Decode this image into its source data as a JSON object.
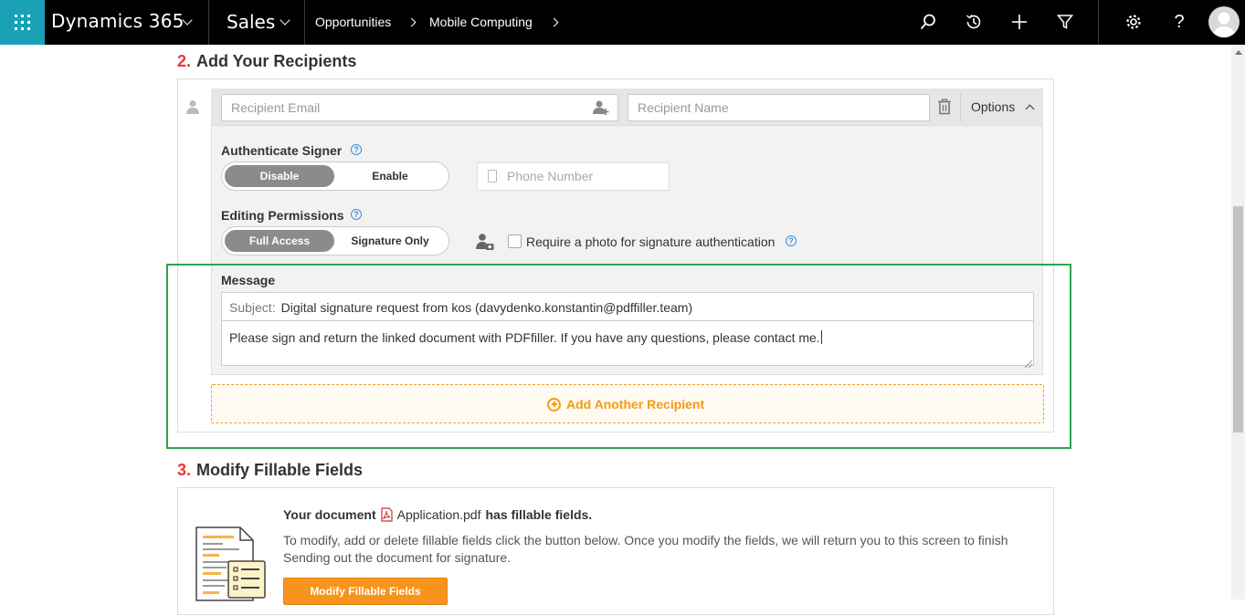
{
  "topbar": {
    "brand": "Dynamics 365",
    "app": "Sales",
    "breadcrumbs": [
      "Opportunities",
      "Mobile Computing"
    ],
    "icons": [
      "search-icon",
      "history-icon",
      "plus-icon",
      "filter-icon",
      "gear-icon",
      "help-icon",
      "avatar"
    ]
  },
  "section2": {
    "number": "2.",
    "title": "Add Your Recipients",
    "recipient": {
      "email_placeholder": "Recipient Email",
      "name_placeholder": "Recipient Name",
      "options_label": "Options"
    },
    "authenticate": {
      "label": "Authenticate Signer",
      "options": [
        "Disable",
        "Enable"
      ],
      "selected": "Disable",
      "phone_placeholder": "Phone Number"
    },
    "permissions": {
      "label": "Editing Permissions",
      "options": [
        "Full Access",
        "Signature Only"
      ],
      "selected": "Full Access",
      "photo_checkbox_label": "Require a photo for signature authentication",
      "photo_checked": false
    },
    "message": {
      "label": "Message",
      "subject_prefix": "Subject:",
      "subject": "Digital signature request from kos (davydenko.konstantin@pdffiller.team)",
      "body": "Please sign and return the linked document with PDFfiller. If you have any questions, please contact me."
    },
    "add_another": "Add Another Recipient"
  },
  "section3": {
    "number": "3.",
    "title": "Modify Fillable Fields",
    "your_document": "Your document",
    "filename": "Application.pdf",
    "has_fields": "has fillable fields.",
    "description": "To modify, add or delete fillable fields click the button below. Once you modify the fields, we will return you to this screen to finish Sending out the document for signature.",
    "button": "Modify Fillable Fields"
  },
  "colors": {
    "accent_orange": "#f39c12",
    "waffle": "#1ba1b5",
    "highlight": "#2ea44f",
    "number_red": "#e53935"
  }
}
